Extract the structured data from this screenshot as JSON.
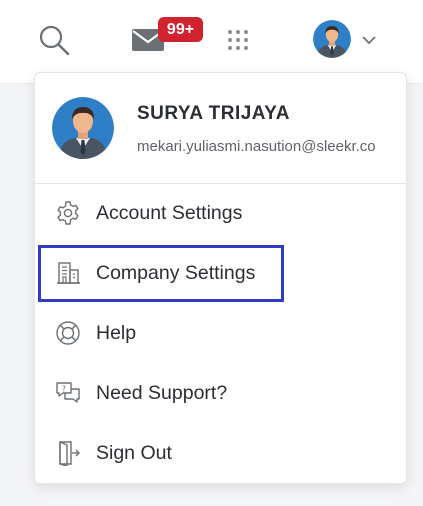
{
  "header": {
    "search_icon": "search-icon",
    "mail_icon": "mail-icon",
    "mail_badge": "99+",
    "apps_icon": "grid-dots-icon",
    "avatar_icon": "user-avatar",
    "chevron_icon": "chevron-down-icon"
  },
  "profile": {
    "name": "SURYA TRIJAYA",
    "email": "mekari.yuliasmi.nasution@sleekr.co"
  },
  "menu": {
    "items": [
      {
        "label": "Account Settings",
        "icon": "gear-icon"
      },
      {
        "label": "Company Settings",
        "icon": "building-icon",
        "highlighted": true
      },
      {
        "label": "Help",
        "icon": "lifebuoy-icon"
      },
      {
        "label": "Need Support?",
        "icon": "chat-question-icon"
      },
      {
        "label": "Sign Out",
        "icon": "door-exit-icon"
      }
    ]
  },
  "colors": {
    "badge": "#d0232f",
    "highlight_border": "#2f3bc2",
    "avatar_bg": "#2f7fc6"
  }
}
